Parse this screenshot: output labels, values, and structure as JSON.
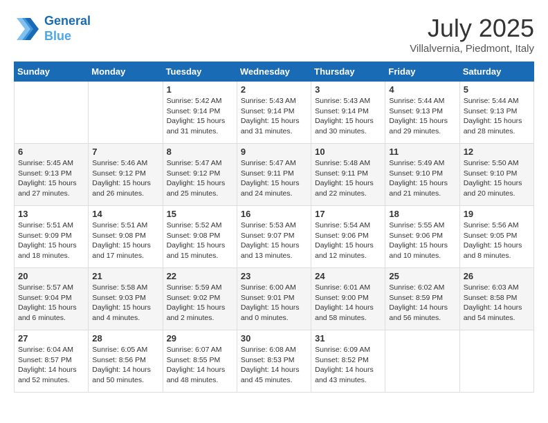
{
  "header": {
    "logo_line1": "General",
    "logo_line2": "Blue",
    "month_year": "July 2025",
    "location": "Villalvernia, Piedmont, Italy"
  },
  "weekdays": [
    "Sunday",
    "Monday",
    "Tuesday",
    "Wednesday",
    "Thursday",
    "Friday",
    "Saturday"
  ],
  "weeks": [
    [
      {
        "day": "",
        "sunrise": "",
        "sunset": "",
        "daylight": ""
      },
      {
        "day": "",
        "sunrise": "",
        "sunset": "",
        "daylight": ""
      },
      {
        "day": "1",
        "sunrise": "Sunrise: 5:42 AM",
        "sunset": "Sunset: 9:14 PM",
        "daylight": "Daylight: 15 hours and 31 minutes."
      },
      {
        "day": "2",
        "sunrise": "Sunrise: 5:43 AM",
        "sunset": "Sunset: 9:14 PM",
        "daylight": "Daylight: 15 hours and 31 minutes."
      },
      {
        "day": "3",
        "sunrise": "Sunrise: 5:43 AM",
        "sunset": "Sunset: 9:14 PM",
        "daylight": "Daylight: 15 hours and 30 minutes."
      },
      {
        "day": "4",
        "sunrise": "Sunrise: 5:44 AM",
        "sunset": "Sunset: 9:13 PM",
        "daylight": "Daylight: 15 hours and 29 minutes."
      },
      {
        "day": "5",
        "sunrise": "Sunrise: 5:44 AM",
        "sunset": "Sunset: 9:13 PM",
        "daylight": "Daylight: 15 hours and 28 minutes."
      }
    ],
    [
      {
        "day": "6",
        "sunrise": "Sunrise: 5:45 AM",
        "sunset": "Sunset: 9:13 PM",
        "daylight": "Daylight: 15 hours and 27 minutes."
      },
      {
        "day": "7",
        "sunrise": "Sunrise: 5:46 AM",
        "sunset": "Sunset: 9:12 PM",
        "daylight": "Daylight: 15 hours and 26 minutes."
      },
      {
        "day": "8",
        "sunrise": "Sunrise: 5:47 AM",
        "sunset": "Sunset: 9:12 PM",
        "daylight": "Daylight: 15 hours and 25 minutes."
      },
      {
        "day": "9",
        "sunrise": "Sunrise: 5:47 AM",
        "sunset": "Sunset: 9:11 PM",
        "daylight": "Daylight: 15 hours and 24 minutes."
      },
      {
        "day": "10",
        "sunrise": "Sunrise: 5:48 AM",
        "sunset": "Sunset: 9:11 PM",
        "daylight": "Daylight: 15 hours and 22 minutes."
      },
      {
        "day": "11",
        "sunrise": "Sunrise: 5:49 AM",
        "sunset": "Sunset: 9:10 PM",
        "daylight": "Daylight: 15 hours and 21 minutes."
      },
      {
        "day": "12",
        "sunrise": "Sunrise: 5:50 AM",
        "sunset": "Sunset: 9:10 PM",
        "daylight": "Daylight: 15 hours and 20 minutes."
      }
    ],
    [
      {
        "day": "13",
        "sunrise": "Sunrise: 5:51 AM",
        "sunset": "Sunset: 9:09 PM",
        "daylight": "Daylight: 15 hours and 18 minutes."
      },
      {
        "day": "14",
        "sunrise": "Sunrise: 5:51 AM",
        "sunset": "Sunset: 9:08 PM",
        "daylight": "Daylight: 15 hours and 17 minutes."
      },
      {
        "day": "15",
        "sunrise": "Sunrise: 5:52 AM",
        "sunset": "Sunset: 9:08 PM",
        "daylight": "Daylight: 15 hours and 15 minutes."
      },
      {
        "day": "16",
        "sunrise": "Sunrise: 5:53 AM",
        "sunset": "Sunset: 9:07 PM",
        "daylight": "Daylight: 15 hours and 13 minutes."
      },
      {
        "day": "17",
        "sunrise": "Sunrise: 5:54 AM",
        "sunset": "Sunset: 9:06 PM",
        "daylight": "Daylight: 15 hours and 12 minutes."
      },
      {
        "day": "18",
        "sunrise": "Sunrise: 5:55 AM",
        "sunset": "Sunset: 9:06 PM",
        "daylight": "Daylight: 15 hours and 10 minutes."
      },
      {
        "day": "19",
        "sunrise": "Sunrise: 5:56 AM",
        "sunset": "Sunset: 9:05 PM",
        "daylight": "Daylight: 15 hours and 8 minutes."
      }
    ],
    [
      {
        "day": "20",
        "sunrise": "Sunrise: 5:57 AM",
        "sunset": "Sunset: 9:04 PM",
        "daylight": "Daylight: 15 hours and 6 minutes."
      },
      {
        "day": "21",
        "sunrise": "Sunrise: 5:58 AM",
        "sunset": "Sunset: 9:03 PM",
        "daylight": "Daylight: 15 hours and 4 minutes."
      },
      {
        "day": "22",
        "sunrise": "Sunrise: 5:59 AM",
        "sunset": "Sunset: 9:02 PM",
        "daylight": "Daylight: 15 hours and 2 minutes."
      },
      {
        "day": "23",
        "sunrise": "Sunrise: 6:00 AM",
        "sunset": "Sunset: 9:01 PM",
        "daylight": "Daylight: 15 hours and 0 minutes."
      },
      {
        "day": "24",
        "sunrise": "Sunrise: 6:01 AM",
        "sunset": "Sunset: 9:00 PM",
        "daylight": "Daylight: 14 hours and 58 minutes."
      },
      {
        "day": "25",
        "sunrise": "Sunrise: 6:02 AM",
        "sunset": "Sunset: 8:59 PM",
        "daylight": "Daylight: 14 hours and 56 minutes."
      },
      {
        "day": "26",
        "sunrise": "Sunrise: 6:03 AM",
        "sunset": "Sunset: 8:58 PM",
        "daylight": "Daylight: 14 hours and 54 minutes."
      }
    ],
    [
      {
        "day": "27",
        "sunrise": "Sunrise: 6:04 AM",
        "sunset": "Sunset: 8:57 PM",
        "daylight": "Daylight: 14 hours and 52 minutes."
      },
      {
        "day": "28",
        "sunrise": "Sunrise: 6:05 AM",
        "sunset": "Sunset: 8:56 PM",
        "daylight": "Daylight: 14 hours and 50 minutes."
      },
      {
        "day": "29",
        "sunrise": "Sunrise: 6:07 AM",
        "sunset": "Sunset: 8:55 PM",
        "daylight": "Daylight: 14 hours and 48 minutes."
      },
      {
        "day": "30",
        "sunrise": "Sunrise: 6:08 AM",
        "sunset": "Sunset: 8:53 PM",
        "daylight": "Daylight: 14 hours and 45 minutes."
      },
      {
        "day": "31",
        "sunrise": "Sunrise: 6:09 AM",
        "sunset": "Sunset: 8:52 PM",
        "daylight": "Daylight: 14 hours and 43 minutes."
      },
      {
        "day": "",
        "sunrise": "",
        "sunset": "",
        "daylight": ""
      },
      {
        "day": "",
        "sunrise": "",
        "sunset": "",
        "daylight": ""
      }
    ]
  ]
}
